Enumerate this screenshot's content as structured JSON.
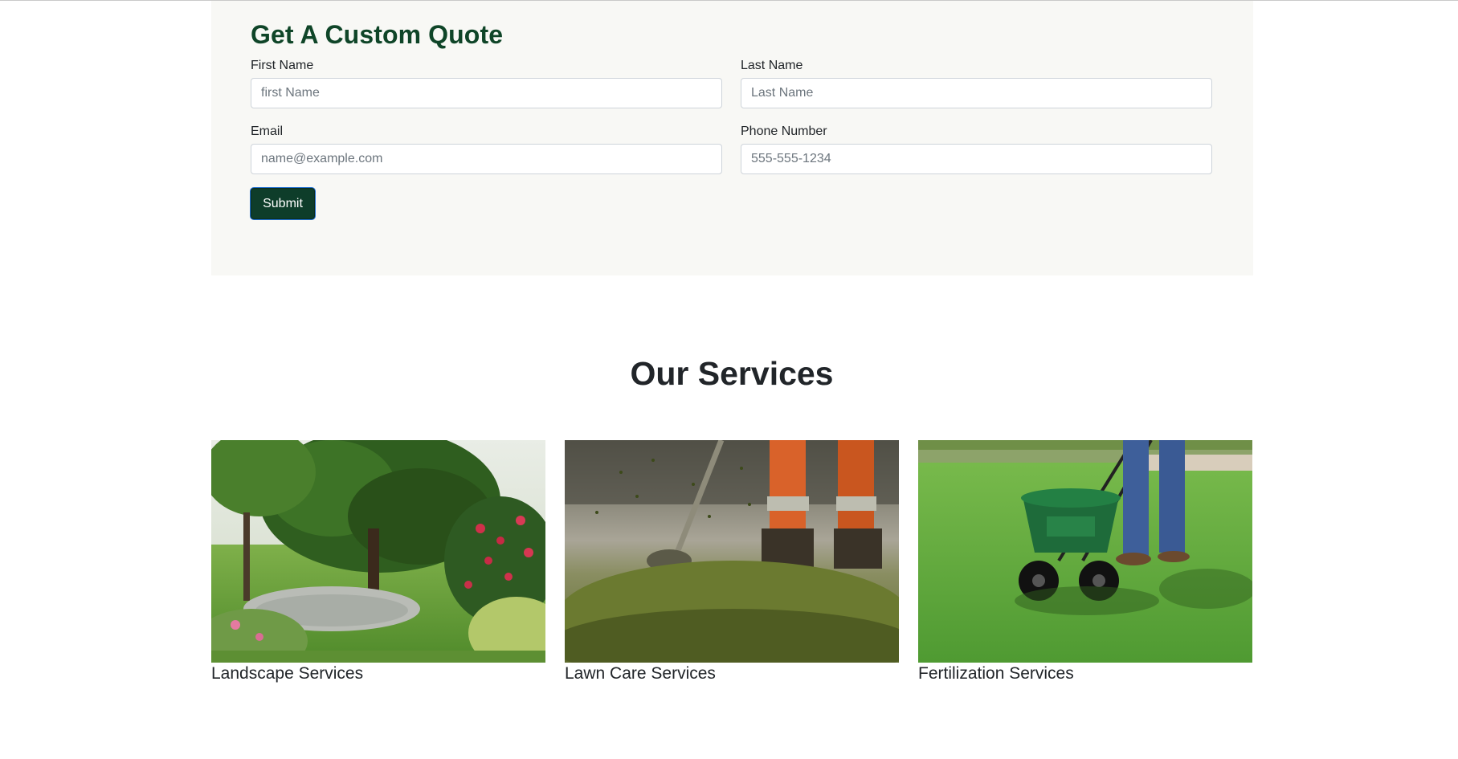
{
  "quote_form": {
    "title": "Get A Custom Quote",
    "first_name": {
      "label": "First Name",
      "placeholder": "first Name",
      "value": ""
    },
    "last_name": {
      "label": "Last Name",
      "placeholder": "Last Name",
      "value": ""
    },
    "email": {
      "label": "Email",
      "placeholder": "name@example.com",
      "value": ""
    },
    "phone": {
      "label": "Phone Number",
      "placeholder": "555-555-1234",
      "value": ""
    },
    "submit_label": "Submit"
  },
  "services": {
    "title": "Our Services",
    "items": [
      {
        "name": "Landscape Services",
        "image": "garden-pond-photo"
      },
      {
        "name": "Lawn Care Services",
        "image": "string-trimmer-photo"
      },
      {
        "name": "Fertilization Services",
        "image": "fertilizer-spreader-photo"
      }
    ]
  },
  "colors": {
    "brand_green": "#0f4528",
    "button_bg": "#0e3d2a",
    "panel_bg": "#f8f8f5"
  }
}
